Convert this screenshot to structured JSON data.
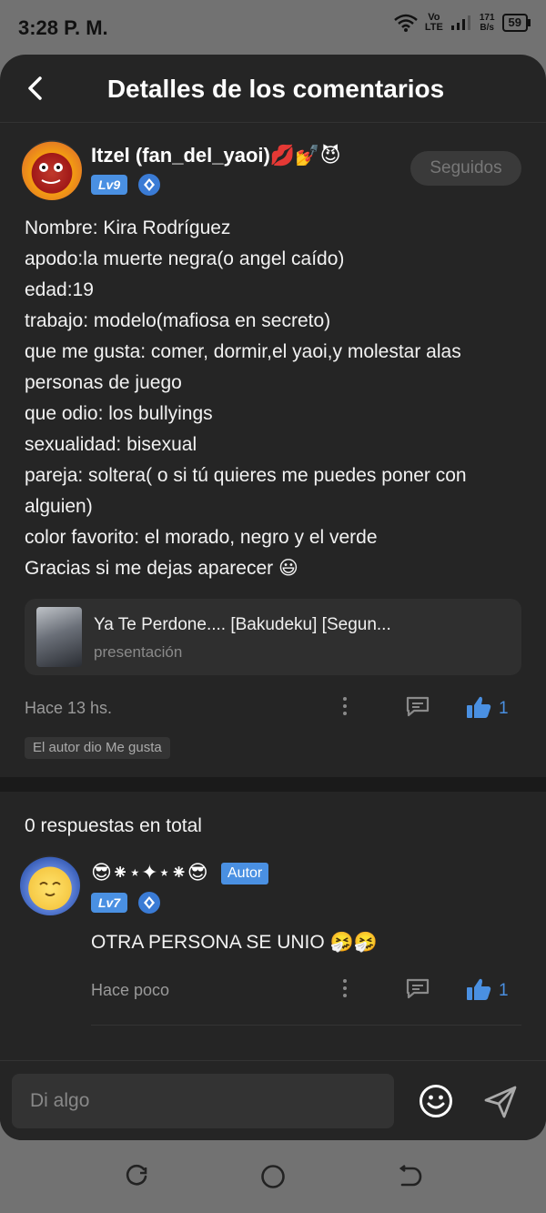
{
  "status_bar": {
    "time": "3:28 P. M.",
    "network_top": "Vo",
    "network_bottom": "LTE",
    "speed_value": "171",
    "speed_unit": "B/s",
    "battery": "59"
  },
  "header": {
    "title": "Detalles de los comentarios"
  },
  "post": {
    "username": "Itzel (fan_del_yaoi)💋💅😈",
    "level": "Lv9",
    "follow_label": "Seguidos",
    "lines": [
      "Nombre: Kira Rodríguez",
      "apodo:la muerte negra(o angel caído)",
      "edad:19",
      "trabajo: modelo(mafiosa en secreto)",
      "que me gusta: comer, dormir,el yaoi,y molestar alas",
      "personas de juego",
      "que odio: los bullyings",
      "sexualidad: bisexual",
      "pareja: soltera( o si tú quieres me puedes poner con",
      "alguien)",
      "color favorito: el morado,  negro y el verde",
      "Gracias si me dejas aparecer 😃"
    ],
    "link": {
      "title": "Ya Te Perdone.... [Bakudeku] [Segun...",
      "subtitle": "presentación"
    },
    "time": "Hace 13 hs.",
    "likes": "1",
    "author_liked": "El autor dio Me gusta"
  },
  "replies": {
    "total_label": "0 respuestas en total",
    "items": [
      {
        "name": "😎⁕⋆✦⋆⁕😎",
        "badge": "Autor",
        "level": "Lv7",
        "text": "OTRA PERSONA SE UNIO 🤧🤧",
        "time": "Hace poco",
        "likes": "1"
      }
    ]
  },
  "composer": {
    "placeholder": "Di algo"
  },
  "colors": {
    "accent": "#4a90e2",
    "background": "#252525",
    "status_bar": "#727272"
  }
}
